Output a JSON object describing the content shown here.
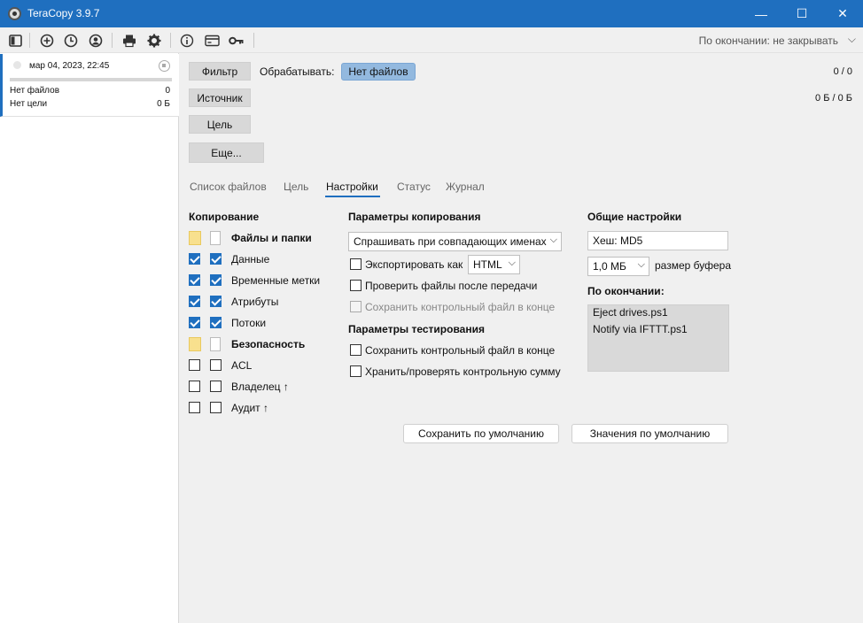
{
  "window": {
    "title": "TeraCopy 3.9.7",
    "controls": {
      "minimize": "—",
      "maximize": "☐",
      "close": "✕"
    }
  },
  "toolbar": {
    "icons": [
      "panel-icon",
      "add-icon",
      "history-icon",
      "favorites-icon",
      "print-icon",
      "settings-icon",
      "info-icon",
      "license-icon",
      "key-icon"
    ],
    "after_finish": "По окончании: не закрывать"
  },
  "job": {
    "date": "мар 04, 2023, 22:45",
    "files_label": "Нет файлов",
    "files_value": "0",
    "target_label": "Нет цели",
    "target_value": "0 Б",
    "progress": 0
  },
  "actions": {
    "filter": "Фильтр",
    "source": "Источник",
    "target": "Цель",
    "more": "Еще...",
    "process_label": "Обрабатывать:",
    "no_files": "Нет файлов",
    "count": "0 / 0",
    "size": "0 Б / 0 Б"
  },
  "tabs": [
    "Список файлов",
    "Цель",
    "Настройки",
    "Статус",
    "Журнал"
  ],
  "copying": {
    "header": "Копирование",
    "files_folders": "Файлы и папки",
    "items": [
      {
        "label": "Данные",
        "checked": true
      },
      {
        "label": "Временные метки",
        "checked": true
      },
      {
        "label": "Атрибуты",
        "checked": true
      },
      {
        "label": "Потоки",
        "checked": true
      }
    ],
    "security": "Безопасность",
    "security_items": [
      {
        "label": "ACL",
        "checked": false
      },
      {
        "label": "Владелец ↑",
        "checked": false
      },
      {
        "label": "Аудит ↑",
        "checked": false
      }
    ]
  },
  "copy_params": {
    "header": "Параметры копирования",
    "conflict_combo": "Спрашивать при совпадающих именах",
    "export_label": "Экспортировать как",
    "export_format": "HTML",
    "verify_label": "Проверить файлы после передачи",
    "save_checksum_label": "Сохранить контрольный файл в конце"
  },
  "test_params": {
    "header": "Параметры тестирования",
    "save_checksum_label": "Сохранить контрольный файл в конце",
    "store_checksum_label": "Хранить/проверять контрольную сумму"
  },
  "general": {
    "header": "Общие настройки",
    "hash": "Хеш: MD5",
    "buffer_value": "1,0 МБ",
    "buffer_label": "размер буфера",
    "on_finish_header": "По окончании:",
    "scripts": [
      "Eject drives.ps1",
      "Notify via IFTTT.ps1"
    ]
  },
  "buttons": {
    "save_default": "Сохранить по умолчанию",
    "defaults": "Значения по умолчанию"
  }
}
